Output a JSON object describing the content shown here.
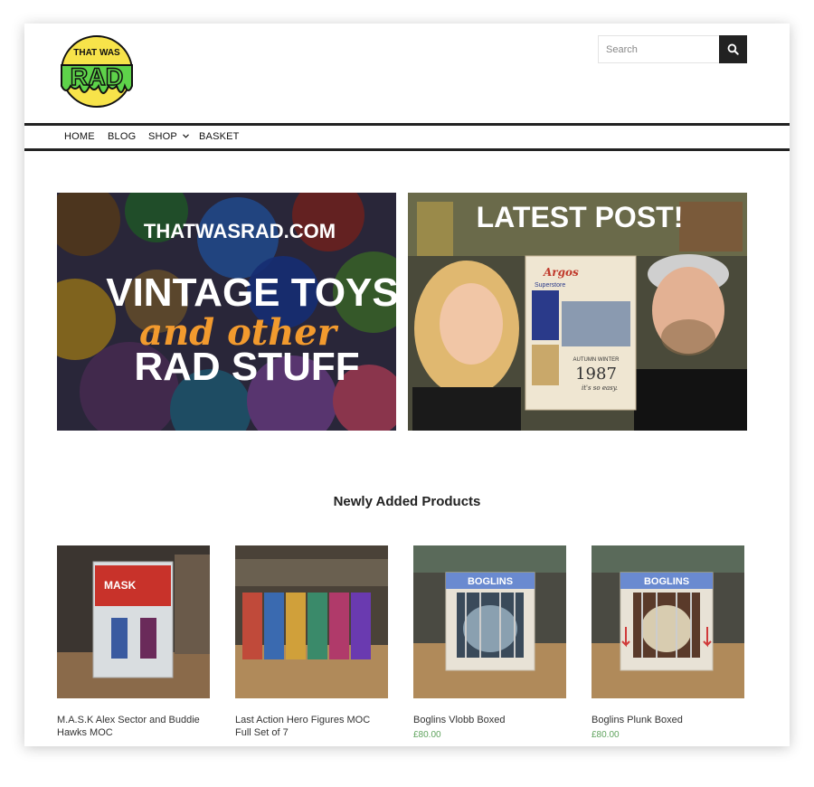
{
  "brand": {
    "logo_top": "THAT WAS",
    "logo_main": "RAD"
  },
  "search": {
    "placeholder": "Search"
  },
  "nav": {
    "items": [
      "HOME",
      "BLOG",
      "SHOP",
      "BASKET"
    ]
  },
  "banners": {
    "left": {
      "site": "THATWASRAD.COM",
      "line1": "VINTAGE TOYS",
      "line2": "and other",
      "line3": "RAD STUFF"
    },
    "right": {
      "title": "LATEST POST!",
      "catalogue_brand": "Argos",
      "catalogue_sub": "Superstore",
      "catalogue_season": "AUTUMN WINTER",
      "catalogue_year": "1987",
      "catalogue_tagline": "it's so easy."
    }
  },
  "products_section": {
    "title": "Newly Added Products"
  },
  "products": [
    {
      "name": "M.A.S.K Alex Sector and Buddie Hawks MOC",
      "price": ""
    },
    {
      "name": "Last Action Hero Figures MOC Full Set of 7",
      "price": ""
    },
    {
      "name": "Boglins Vlobb Boxed",
      "price": "£80.00"
    },
    {
      "name": "Boglins Plunk Boxed",
      "price": "£80.00"
    }
  ],
  "colors": {
    "nav_border": "#222222",
    "price": "#5fa35d",
    "logo_yellow": "#f7e34a",
    "logo_green": "#5ed34a",
    "banner_orange": "#f29a2e"
  }
}
